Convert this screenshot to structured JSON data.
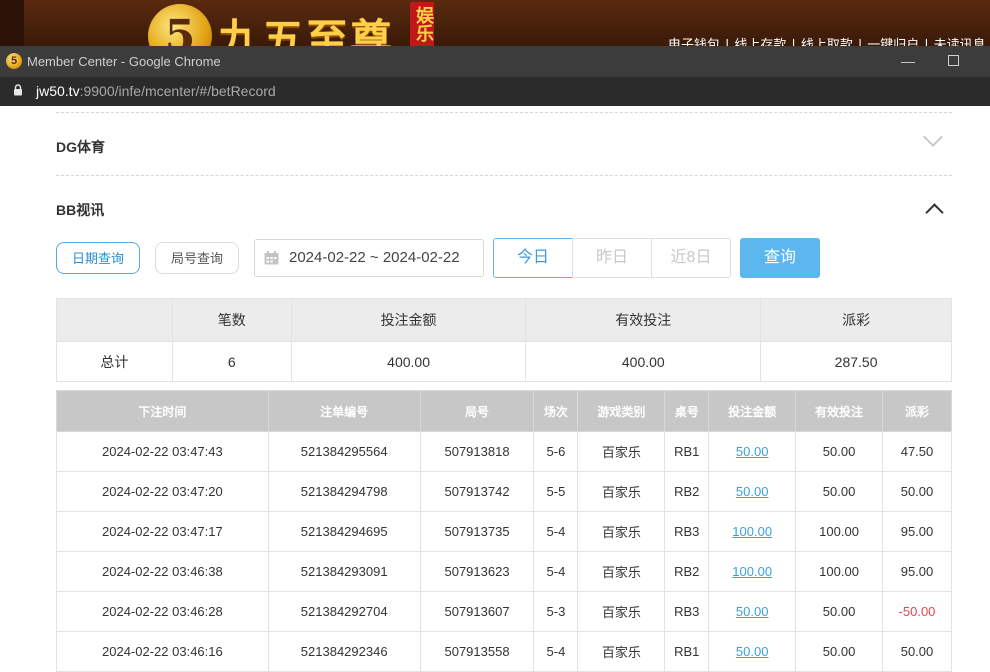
{
  "site": {
    "logo_glyph": "5",
    "brand": "九五至尊",
    "badge": "娱乐",
    "nav": [
      "电子钱包",
      "线上存款",
      "线上取款",
      "一键归户",
      "未读讯息"
    ]
  },
  "window": {
    "title": "Member Center - Google Chrome",
    "url_host": "jw50.tv",
    "url_rest": ":9900/infe/mcenter/#/betRecord"
  },
  "sections": {
    "dg_title": "DG体育",
    "bb_title": "BB视讯"
  },
  "filters": {
    "date_query": "日期查询",
    "round_query": "局号查询",
    "date_range": "2024-02-22 ~ 2024-02-22",
    "today": "今日",
    "yesterday": "昨日",
    "last8": "近8日",
    "search": "查询"
  },
  "summary": {
    "headers": [
      "",
      "笔数",
      "投注金额",
      "有效投注",
      "派彩"
    ],
    "row": [
      "总计",
      "6",
      "400.00",
      "400.00",
      "287.50"
    ]
  },
  "records": {
    "headers": [
      "下注时间",
      "注单编号",
      "局号",
      "场次",
      "游戏类别",
      "桌号",
      "投注金额",
      "有效投注",
      "派彩"
    ],
    "rows": [
      [
        "2024-02-22 03:47:43",
        "521384295564",
        "507913818",
        "5-6",
        "百家乐",
        "RB1",
        "50.00",
        "50.00",
        "47.50"
      ],
      [
        "2024-02-22 03:47:20",
        "521384294798",
        "507913742",
        "5-5",
        "百家乐",
        "RB2",
        "50.00",
        "50.00",
        "50.00"
      ],
      [
        "2024-02-22 03:47:17",
        "521384294695",
        "507913735",
        "5-4",
        "百家乐",
        "RB3",
        "100.00",
        "100.00",
        "95.00"
      ],
      [
        "2024-02-22 03:46:38",
        "521384293091",
        "507913623",
        "5-4",
        "百家乐",
        "RB2",
        "100.00",
        "100.00",
        "95.00"
      ],
      [
        "2024-02-22 03:46:28",
        "521384292704",
        "507913607",
        "5-3",
        "百家乐",
        "RB3",
        "50.00",
        "50.00",
        "-50.00"
      ],
      [
        "2024-02-22 03:46:16",
        "521384292346",
        "507913558",
        "5-4",
        "百家乐",
        "RB1",
        "50.00",
        "50.00",
        "50.00"
      ]
    ]
  },
  "colors": {
    "accent": "#5cb7ef",
    "link": "#3aa0e0",
    "negative": "#e5484d",
    "header_gray": "#c7c7c7"
  }
}
